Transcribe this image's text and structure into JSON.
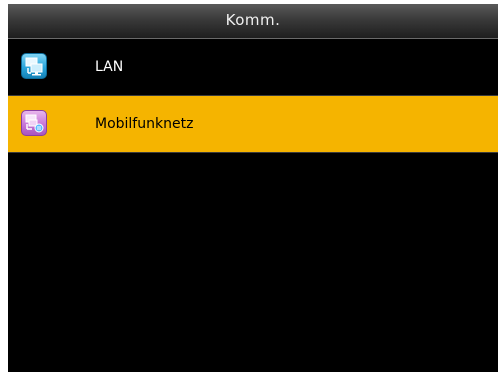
{
  "header": {
    "title": "Komm."
  },
  "menu": {
    "items": [
      {
        "label": "LAN",
        "icon": "lan-network-icon",
        "selected": false
      },
      {
        "label": "Mobilfunknetz",
        "icon": "mobile-network-icon",
        "selected": true
      }
    ]
  },
  "colors": {
    "screen_background": "#000000",
    "selection_highlight": "#f5b400",
    "title_text": "#f0f0f0"
  }
}
